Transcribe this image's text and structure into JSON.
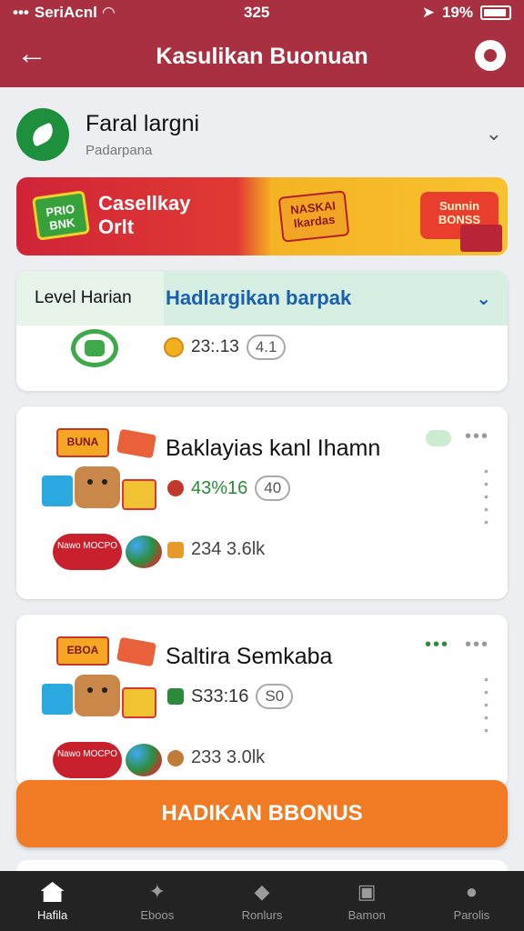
{
  "status": {
    "carrier": "SeriAcnl",
    "time": "325",
    "battery": "19%"
  },
  "header": {
    "title": "Kasulikan Buonuan"
  },
  "profile": {
    "name": "Faral largni",
    "subtitle": "Padarpana"
  },
  "banner": {
    "badge": "PRIO BNK",
    "line1": "Casellkay",
    "line2": "Orlt",
    "sign1": "NASKAI Ikardas",
    "sign2": "Sunnin BONSS"
  },
  "level": {
    "tab_label": "Level Harian",
    "tab_title": "Hadlargikan barpak",
    "coins": "23:.13",
    "pill": "4.1"
  },
  "offers": [
    {
      "art_label": "BUNA",
      "bubble": "Nawo MOCPO",
      "title": "Baklayias kanl Ihamn",
      "value": "43%16",
      "pill": "40",
      "secondary": "234 3.6lk"
    },
    {
      "art_label": "EBOA",
      "bubble": "Nawo MOCPO",
      "title": "Saltira Semkaba",
      "value": "S33:16",
      "pill": "S0",
      "secondary": "233 3.0lk"
    }
  ],
  "cta": {
    "label": "HADIKAN BBONUS"
  },
  "nav": [
    {
      "label": "Hafila",
      "icon": "home-icon"
    },
    {
      "label": "Eboos",
      "icon": "bird-icon"
    },
    {
      "label": "Ronlurs",
      "icon": "diamond-icon"
    },
    {
      "label": "Bamon",
      "icon": "window-icon"
    },
    {
      "label": "Parolis",
      "icon": "person-icon"
    }
  ],
  "colors": {
    "header": "#a83040",
    "cta": "#f07b24",
    "accent_blue": "#1a5fb0",
    "green": "#2a8a3a",
    "nav_bg": "#232323"
  }
}
